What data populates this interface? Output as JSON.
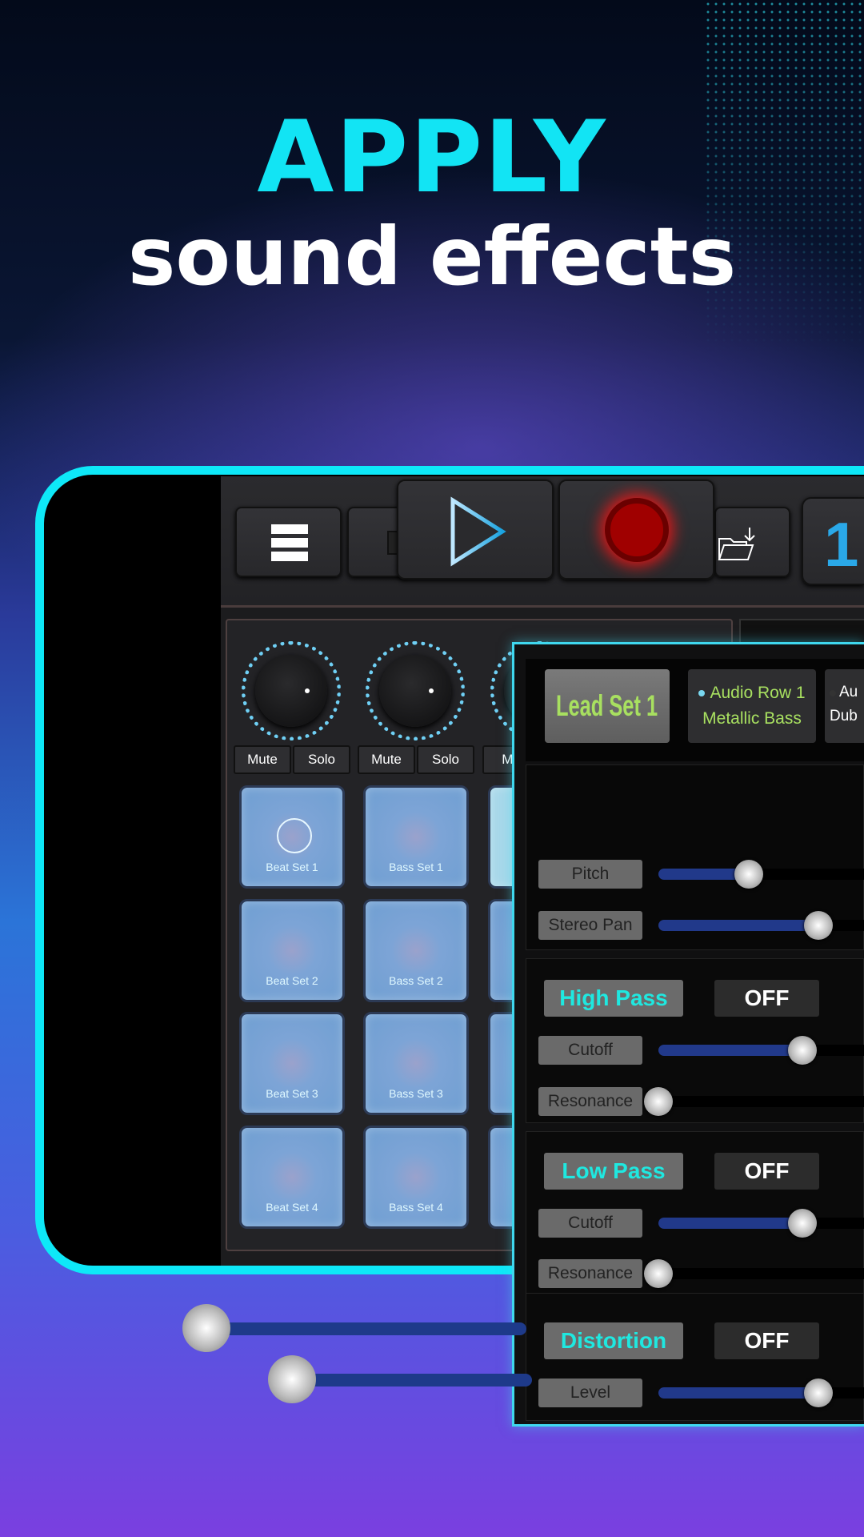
{
  "headline": {
    "line1": "APPLY",
    "line2": "sound effects"
  },
  "colors": {
    "accent": "#0ee8f8",
    "title_cyan": "#12e4f4",
    "fx_title": "#1fe8e0",
    "lead_green": "#a8e060",
    "slider_fill": "#21398a",
    "record_red": "#a00000"
  },
  "toolbar": {
    "icons": [
      "menu-icon",
      "play-icon",
      "record-icon",
      "folder-download-icon"
    ],
    "next_label": "1"
  },
  "mixer": {
    "mute_label": "Mute",
    "solo_label": "Solo",
    "mute_partial": "Mu",
    "pads": [
      [
        "Beat Set 1",
        "Bass Set 1"
      ],
      [
        "Beat Set 2",
        "Bass Set 2"
      ],
      [
        "Beat Set 3",
        "Bass Set 3"
      ],
      [
        "Beat Set 4",
        "Bass Set 4"
      ]
    ]
  },
  "fx": {
    "presets": [
      {
        "label": "Lead Set 1"
      },
      {
        "line1": "Audio Row 1",
        "line2": "Metallic Bass"
      },
      {
        "line1": "Au",
        "line2": "Dub"
      }
    ],
    "main_sliders": [
      {
        "label": "Pitch",
        "value": 0.45
      },
      {
        "label": "Stereo Pan",
        "value": 0.8
      }
    ],
    "sections": [
      {
        "title": "High Pass",
        "state": "OFF",
        "sliders": [
          {
            "label": "Cutoff",
            "value": 0.72
          },
          {
            "label": "Resonance",
            "value": 0
          }
        ]
      },
      {
        "title": "Low Pass",
        "state": "OFF",
        "sliders": [
          {
            "label": "Cutoff",
            "value": 0.72
          },
          {
            "label": "Resonance",
            "value": 0
          }
        ]
      },
      {
        "title": "Distortion",
        "state": "OFF",
        "sliders": [
          {
            "label": "Level",
            "value": 0.8
          }
        ]
      }
    ]
  }
}
